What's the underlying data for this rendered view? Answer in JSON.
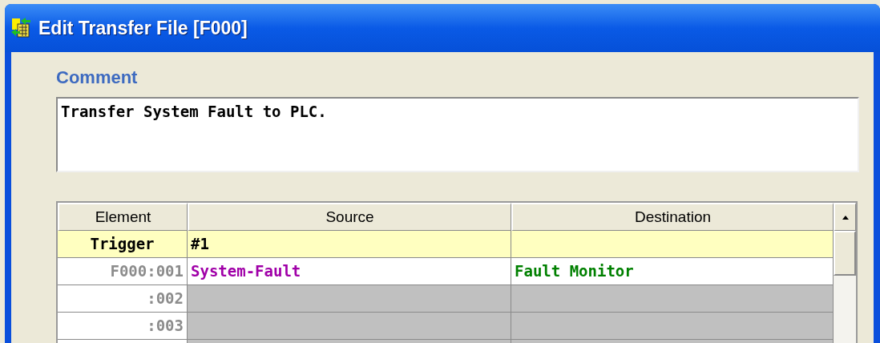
{
  "window": {
    "title": "Edit Transfer File [F000]"
  },
  "comment": {
    "label": "Comment",
    "value": "Transfer System Fault to PLC."
  },
  "table": {
    "columns": [
      "Element",
      "Source",
      "Destination"
    ],
    "rows": [
      {
        "kind": "trigger",
        "element": "Trigger",
        "source": "#1"
      },
      {
        "kind": "entry",
        "element": "F000:001",
        "source": "System-Fault",
        "destination": "Fault Monitor"
      },
      {
        "kind": "empty",
        "element": ":002"
      },
      {
        "kind": "empty",
        "element": ":003"
      }
    ]
  }
}
